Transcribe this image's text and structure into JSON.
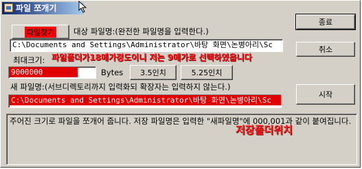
{
  "window": {
    "title": "파일 쪼개기"
  },
  "buttons": {
    "open_file": "파일찾기",
    "close": "종료",
    "cancel": "취소",
    "floppy_35": "3.5인치",
    "floppy_525": "5.25인치",
    "start": "시작"
  },
  "source": {
    "label": "대상 파일명:(완전한 파일명을 입력한다.)",
    "path": "C:\\Documents and Settings\\Administrator\\바탕 화면\\논병아리\\Sc"
  },
  "size": {
    "label": "최대크기:",
    "value": "9000000",
    "unit": "Bytes"
  },
  "dest": {
    "label": "새 파일명:(서브디렉토리까지 입력화되 확장자는 입력하지 않는다.)",
    "path": "C:\\Documents and Settings\\Administrator\\바탕 화면\\논병아리\\Sc"
  },
  "description": "주어진 크기로 파일을 쪼개어 줍니다. 저장 파일명은 입력한 \"새파일명\"에 000,001과 같이 붙여집니다.",
  "annotations": {
    "size_note": "파일폴더가18메가정도이니 저는 9메가로 선택하였읍니다",
    "save_note": "저장폴더위치"
  },
  "colors": {
    "annotation_red": "#ff2020",
    "titlebar_start": "#0a246a",
    "titlebar_end": "#a6caf0"
  }
}
